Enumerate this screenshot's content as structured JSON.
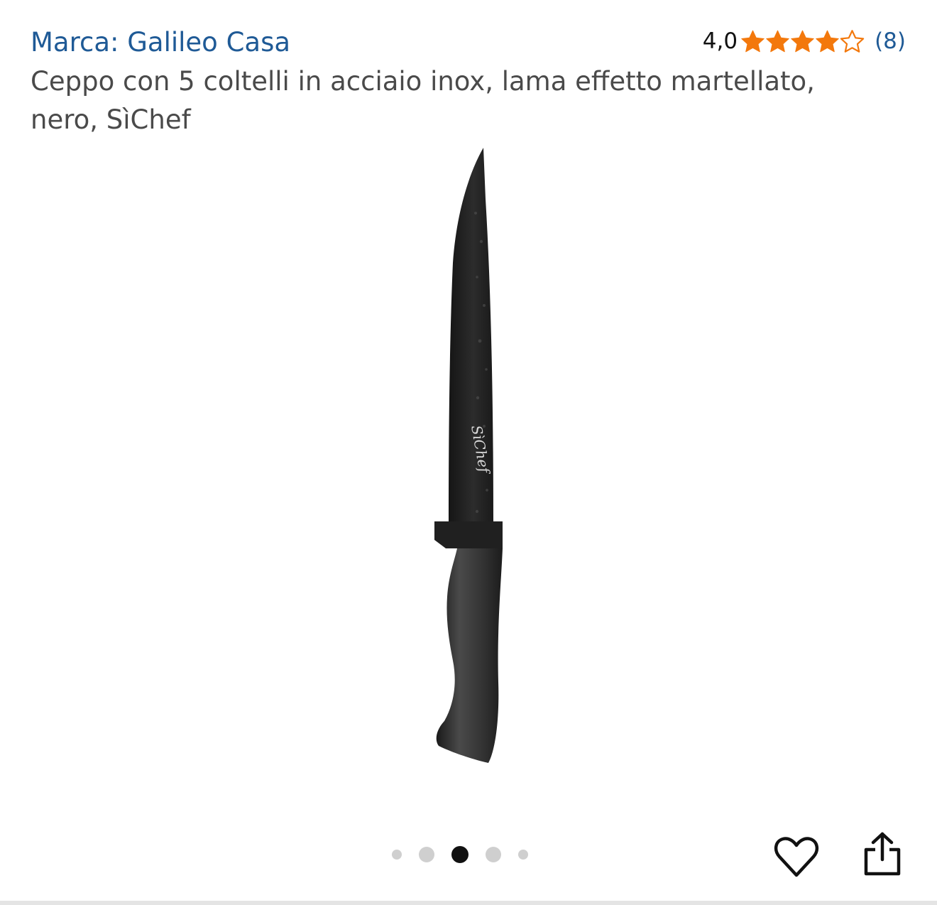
{
  "product": {
    "brand_label": "Marca: Galileo Casa",
    "title": "Ceppo con 5 coltelli in acciaio inox, lama effetto martellato, nero, SìChef",
    "image_alt": "Coltello nero con lama effetto martellato",
    "blade_engraving": "SìChef"
  },
  "rating": {
    "value": "4,0",
    "stars": 4,
    "max_stars": 5,
    "review_count": "(8)",
    "star_color": "#f3780c"
  },
  "gallery": {
    "total_images": 5,
    "active_index": 2
  },
  "actions": {
    "wishlist_icon": "heart-outline-icon",
    "share_icon": "share-upload-icon"
  },
  "colors": {
    "link": "#1f5a96",
    "text": "#4a4a4a",
    "dot_inactive": "#cfcfcf",
    "dot_active": "#111111"
  }
}
